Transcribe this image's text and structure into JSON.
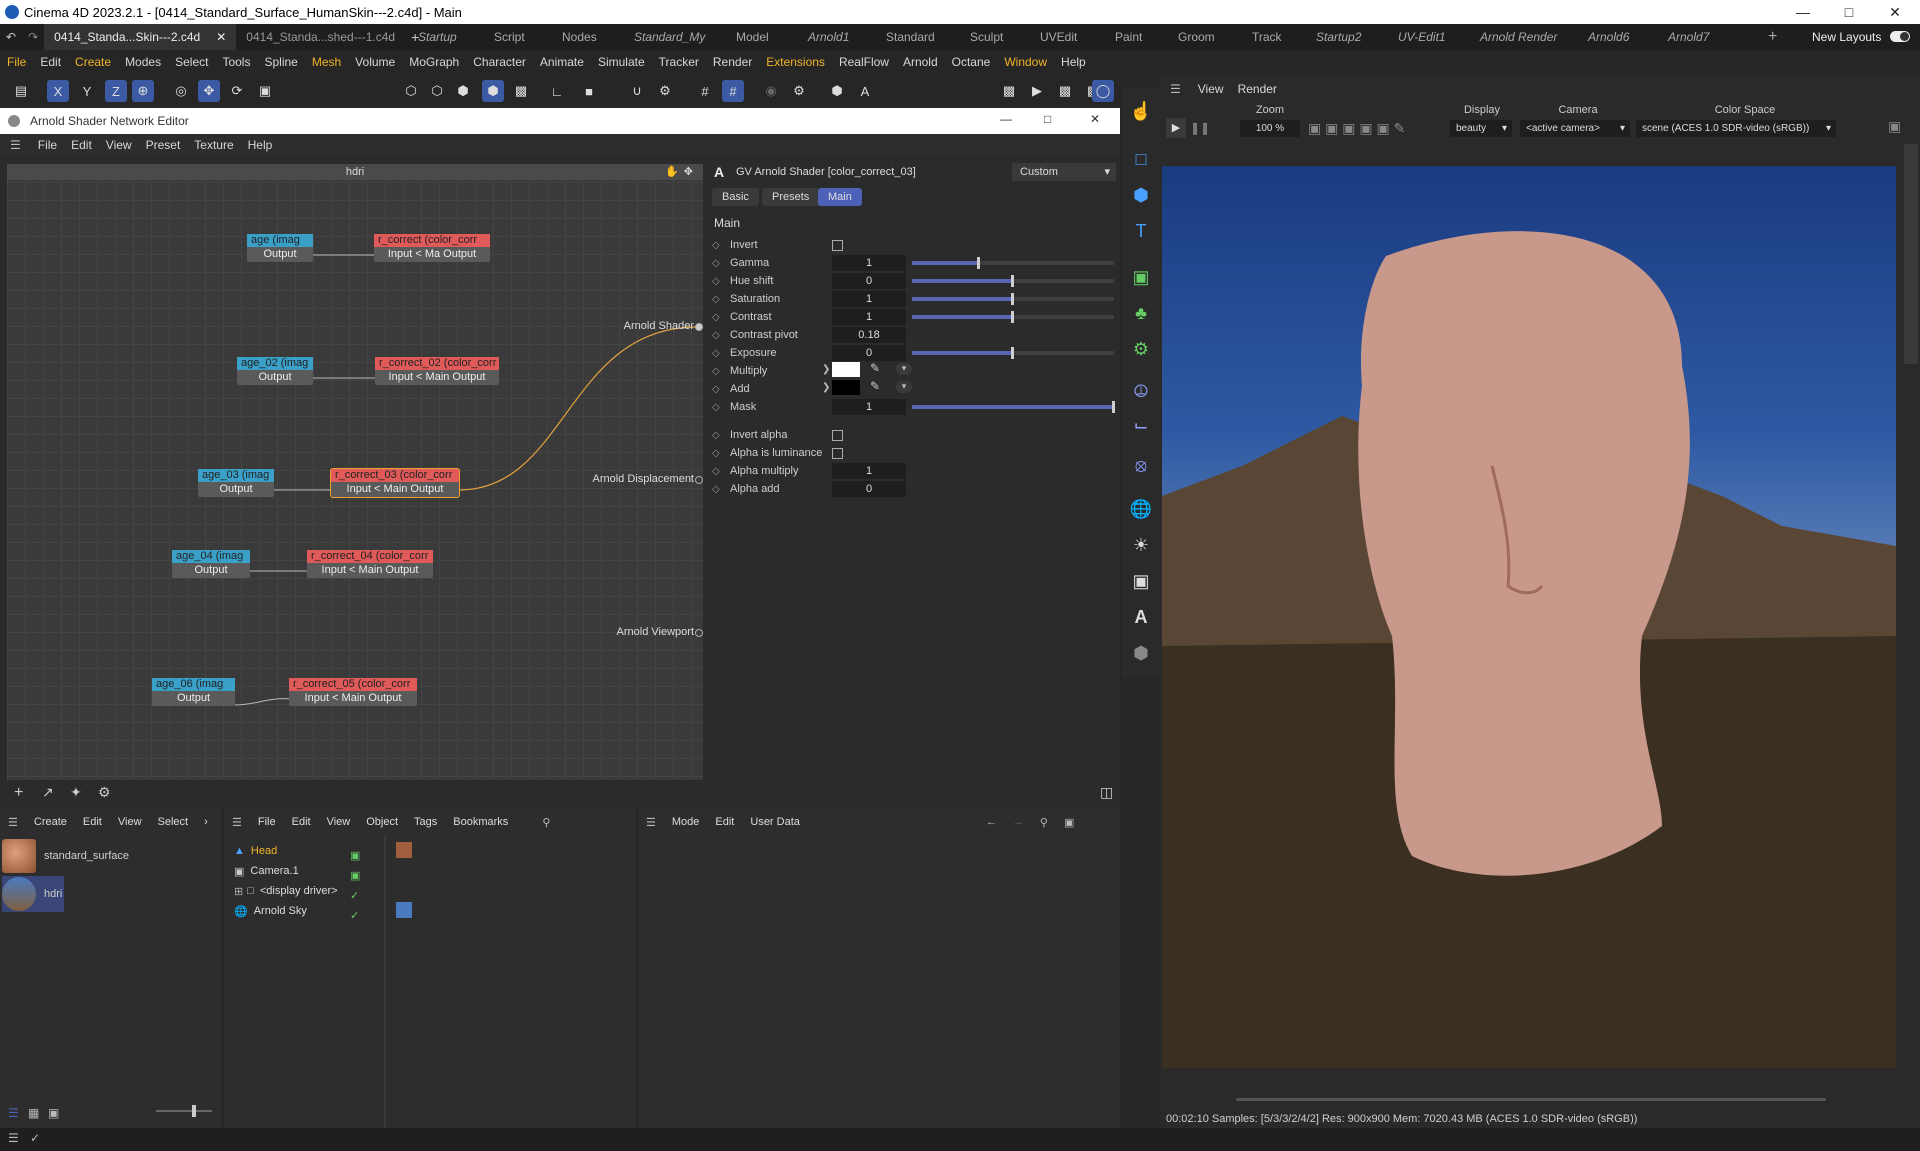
{
  "window": {
    "title": "Cinema 4D 2023.2.1 - [0414_Standard_Surface_HumanSkin---2.c4d] - Main"
  },
  "tabs": {
    "docs": [
      "0414_Standa...Skin---2.c4d",
      "0414_Standa...shed---1.c4d"
    ],
    "layouts": [
      "Startup",
      "Script",
      "Nodes",
      "Standard_My",
      "Model",
      "Arnold1",
      "Standard",
      "Sculpt",
      "UVEdit",
      "Paint",
      "Groom",
      "Track",
      "Startup2",
      "UV-Edit1",
      "Arnold Render",
      "Arnold6",
      "Arnold7"
    ],
    "new_layouts": "New Layouts"
  },
  "menu": [
    "File",
    "Edit",
    "Create",
    "Modes",
    "Select",
    "Tools",
    "Spline",
    "Mesh",
    "Volume",
    "MoGraph",
    "Character",
    "Animate",
    "Simulate",
    "Tracker",
    "Render",
    "Extensions",
    "RealFlow",
    "Arnold",
    "Octane",
    "Window",
    "Help"
  ],
  "toolbar": {
    "axes": [
      "X",
      "Y",
      "Z"
    ]
  },
  "shader_editor": {
    "title": "Arnold Shader Network Editor",
    "menu": [
      "File",
      "Edit",
      "View",
      "Preset",
      "Texture",
      "Help"
    ],
    "graph_title": "hdri",
    "nodes": [
      {
        "head": "age (imag",
        "body": "Output"
      },
      {
        "head": "r_correct (color_corr",
        "body": "Input < Ma Output"
      },
      {
        "head": "age_02 (imag",
        "body": "Output"
      },
      {
        "head": "r_correct_02 (color_corr",
        "body": "Input < Main Output"
      },
      {
        "head": "age_03 (imag",
        "body": "Output"
      },
      {
        "head": "r_correct_03 (color_corr",
        "body": "Input < Main Output"
      },
      {
        "head": "age_04 (imag",
        "body": "Output"
      },
      {
        "head": "r_correct_04 (color_corr",
        "body": "Input < Main Output"
      },
      {
        "head": "age_06 (imag",
        "body": "Output"
      },
      {
        "head": "r_correct_05 (color_corr",
        "body": "Input < Main Output"
      }
    ],
    "outputs": [
      "Arnold Shader",
      "Arnold Displacement",
      "Arnold Viewport"
    ],
    "attr": {
      "header": "GV Arnold Shader [color_correct_03]",
      "preset": "Custom",
      "tabs": [
        "Basic",
        "Presets",
        "Main"
      ],
      "section": "Main",
      "rows": [
        {
          "label": "Invert"
        },
        {
          "label": "Gamma",
          "value": "1"
        },
        {
          "label": "Hue shift",
          "value": "0"
        },
        {
          "label": "Saturation",
          "value": "1"
        },
        {
          "label": "Contrast",
          "value": "1"
        },
        {
          "label": "Contrast pivot",
          "value": "0.18"
        },
        {
          "label": "Exposure",
          "value": "0"
        },
        {
          "label": "Multiply"
        },
        {
          "label": "Add"
        },
        {
          "label": "Mask",
          "value": "1"
        },
        {
          "label": "Invert alpha"
        },
        {
          "label": "Alpha is luminance"
        },
        {
          "label": "Alpha multiply",
          "value": "1"
        },
        {
          "label": "Alpha add",
          "value": "0"
        }
      ],
      "slider_levels": {
        "Gamma": 0.33,
        "Hue shift": 0.5,
        "Saturation": 0.5,
        "Contrast": 0.5,
        "Exposure": 0.5,
        "Mask": 1.0
      }
    }
  },
  "viewport": {
    "menu": [
      "View",
      "Render"
    ],
    "zoom_label": "Zoom",
    "zoom": "100 %",
    "display_label": "Display",
    "display": "beauty",
    "camera_label": "Camera",
    "camera": "<active camera>",
    "colorspace_label": "Color Space",
    "colorspace": "scene (ACES 1.0 SDR-video (sRGB))",
    "status": "00:02:10  Samples: [5/3/3/2/4/2]  Res: 900x900  Mem: 7020.43 MB  (ACES 1.0 SDR-video (sRGB))"
  },
  "material_manager": {
    "menu": [
      "Create",
      "Edit",
      "View",
      "Select"
    ],
    "materials": [
      "standard_surface",
      "hdri"
    ]
  },
  "object_manager": {
    "menu": [
      "File",
      "Edit",
      "View",
      "Object",
      "Tags",
      "Bookmarks"
    ],
    "objects": [
      "Head",
      "Camera.1",
      "<display driver>",
      "Arnold Sky"
    ]
  },
  "attribute_manager": {
    "menu": [
      "Mode",
      "Edit",
      "User Data"
    ]
  },
  "colors": {
    "accent": "#4d61b8",
    "highlight": "#f0b429",
    "image_node": "#3aa0c8",
    "cc_node": "#e05a5a"
  }
}
